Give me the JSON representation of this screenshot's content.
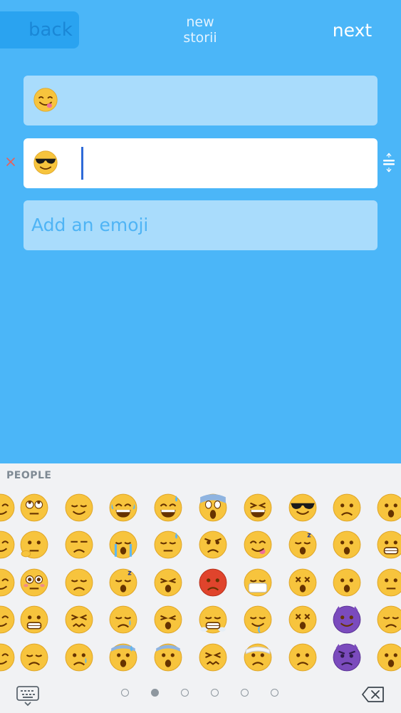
{
  "header": {
    "back_label": "back",
    "title_line1": "new",
    "title_line2": "storii",
    "next_label": "next"
  },
  "rows": [
    {
      "emoji": "face-savouring-food"
    },
    {
      "emoji": "smiling-face-with-sunglasses"
    },
    {
      "placeholder": "Add an emoji"
    }
  ],
  "keyboard": {
    "category_label": "PEOPLE",
    "page_count": 6,
    "active_page": 1,
    "grid_columns": [
      [
        "grin",
        "rolling-eyes",
        "relieved",
        "joy",
        "sweat-smile",
        "scream",
        "laughing",
        "sunglasses",
        "frowning",
        "open-mouth"
      ],
      [
        "smile",
        "thinking",
        "unamused",
        "sob",
        "downcast-sweat",
        "angry",
        "yum",
        "sleeping",
        "anguished",
        "grimacing"
      ],
      [
        "smile",
        "flushed",
        "disappointed",
        "sleepy",
        "weary",
        "rage",
        "mask",
        "dizzy",
        "hushed",
        "neutral"
      ],
      [
        "smile",
        "grimacing",
        "confounded",
        "disappointed-relieved",
        "tired",
        "triumph",
        "drooling",
        "dizzy",
        "imp",
        "confused"
      ],
      [
        "smile",
        "pensive",
        "cry",
        "cold-sweat",
        "fearful",
        "confounded",
        "bandage",
        "worried",
        "angry-imp",
        "open-mouth"
      ]
    ]
  },
  "colors": {
    "background": "#4bb6f8",
    "row_inactive": "#a9dcfc",
    "row_active": "#ffffff",
    "emoji_yellow": "#f7c43d",
    "emoji_purple": "#7b4bbd",
    "emoji_red": "#e0442c",
    "delete_red": "#e9605a"
  }
}
